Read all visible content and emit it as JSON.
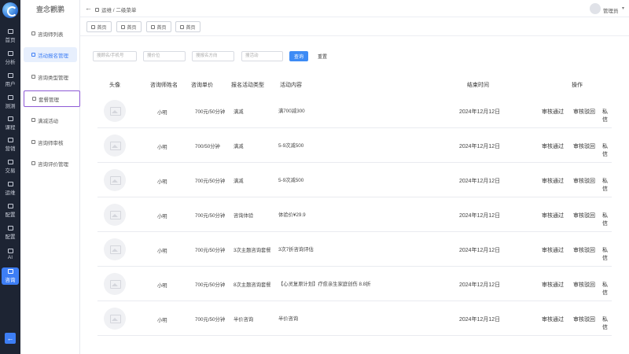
{
  "rail": {
    "items": [
      {
        "label": "首页"
      },
      {
        "label": "分析"
      },
      {
        "label": "用户"
      },
      {
        "label": "测测"
      },
      {
        "label": "课程"
      },
      {
        "label": "营销"
      },
      {
        "label": "交易"
      },
      {
        "label": "运维"
      },
      {
        "label": "配置"
      },
      {
        "label": "配置"
      },
      {
        "label": "AI"
      },
      {
        "label": "咨询"
      }
    ],
    "active_index": 11,
    "back_label": "←"
  },
  "menu": {
    "title": "壹念觀鹏",
    "items": [
      {
        "label": "咨询师列表"
      },
      {
        "label": "活动报名管理"
      },
      {
        "label": "咨询类型管理"
      },
      {
        "label": "套餐管理"
      },
      {
        "label": "满减活动"
      },
      {
        "label": "咨询师审核"
      },
      {
        "label": "咨询评价管理"
      }
    ]
  },
  "header": {
    "back": "←",
    "breadcrumb": "运维 / 二级菜单",
    "user": "管理员",
    "caret": "▾"
  },
  "tabs": [
    {
      "label": "首页"
    },
    {
      "label": "首页"
    },
    {
      "label": "首页"
    },
    {
      "label": "首页"
    }
  ],
  "filters": {
    "name_placeholder": "搜顾名/手机号",
    "price_placeholder": "搜价位",
    "type_placeholder": "搜报名方向",
    "content_placeholder": "搜活动",
    "search_label": "查询",
    "reset_label": "重置"
  },
  "table": {
    "headers": {
      "avatar": "头像",
      "name": "咨询师姓名",
      "price": "咨询单价",
      "type": "报名活动类型",
      "content": "活动内容",
      "time": "结束时间",
      "actions": "操作"
    },
    "rows": [
      {
        "name": "小明",
        "price": "700元/50分钟",
        "type": "满减",
        "content": "满700减300",
        "time": "2024年12月12日"
      },
      {
        "name": "小明",
        "price": "700/50分钟",
        "type": "满减",
        "content": "5-9次减500",
        "time": "2024年12月12日"
      },
      {
        "name": "小明",
        "price": "700元/50分钟",
        "type": "满减",
        "content": "5-9次减500",
        "time": "2024年12月12日"
      },
      {
        "name": "小明",
        "price": "700元/50分钟",
        "type": "咨询体验",
        "content": "体验价¥29.9",
        "time": "2024年12月12日"
      },
      {
        "name": "小明",
        "price": "700元/50分钟",
        "type": "3次主题咨询套餐",
        "content": "3次7折咨询评估",
        "time": "2024年12月12日"
      },
      {
        "name": "小明",
        "price": "700元/50分钟",
        "type": "8次主题咨询套餐",
        "content": "【心灵复原计划】疗愈亲生家庭创伤 8.8折",
        "time": "2024年12月12日"
      },
      {
        "name": "小明",
        "price": "700元/50分钟",
        "type": "半价咨询",
        "content": "半价咨询",
        "time": "2024年12月12日"
      }
    ],
    "actions": {
      "approve": "审核通过",
      "reject": "审核驳回",
      "message": "私信"
    }
  }
}
